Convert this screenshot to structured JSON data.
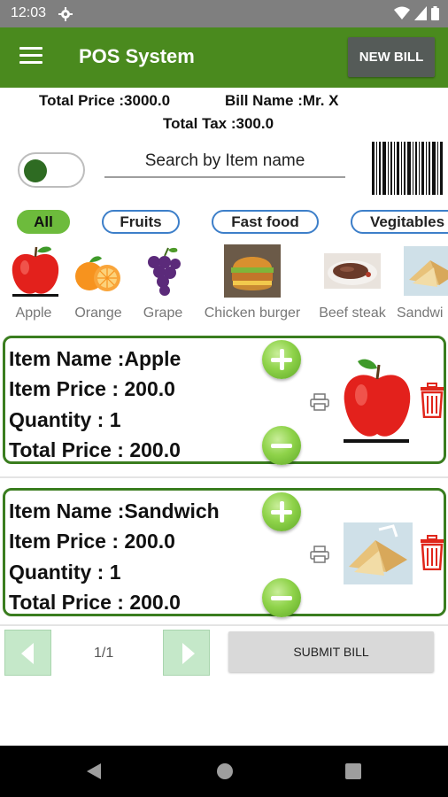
{
  "status_bar": {
    "time": "12:03"
  },
  "app_bar": {
    "title": "POS System",
    "new_bill_label": "NEW BILL"
  },
  "summary": {
    "total_price": "Total Price :3000.0",
    "bill_name": "Bill Name :Mr. X",
    "total_tax": "Total Tax :300.0"
  },
  "search": {
    "placeholder": "Search by Item name"
  },
  "categories": [
    "All",
    "Fruits",
    "Fast food",
    "Vegitables"
  ],
  "products": [
    "Apple",
    "Orange",
    "Grape",
    "Chicken burger",
    "Beef steak",
    "Sandwi"
  ],
  "cart": [
    {
      "name": "Item Name :Apple",
      "price": "Item Price : 200.0",
      "quantity": "Quantity : 1",
      "total": "Total Price : 200.0",
      "image": "apple-image"
    },
    {
      "name": "Item Name :Sandwich",
      "price": "Item Price : 200.0",
      "quantity": "Quantity : 1",
      "total": "Total Price : 200.0",
      "image": "sandwich-image"
    }
  ],
  "pagination": {
    "page": "1/1"
  },
  "submit_label": "SUBMIT BILL",
  "colors": {
    "app_bar": "#4a8a1e",
    "accent_green": "#6dbb3c",
    "card_border": "#3a7d1f",
    "chip_border": "#3d7fc9",
    "delete_red": "#e0261b"
  }
}
